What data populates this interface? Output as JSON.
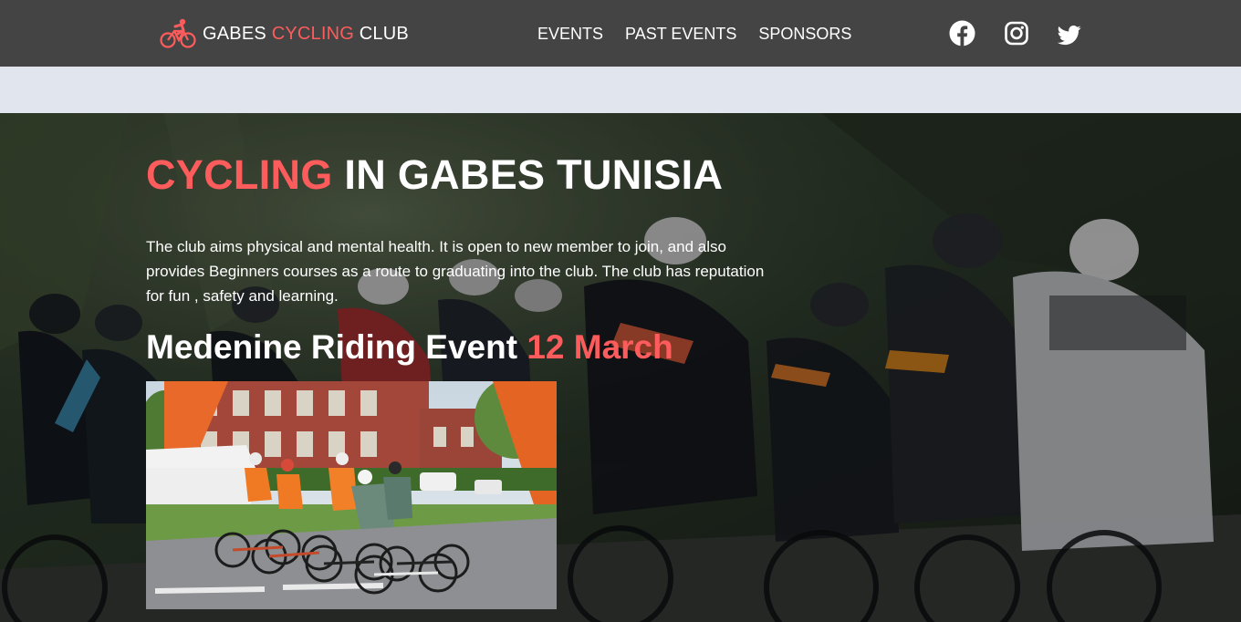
{
  "brand": {
    "name_part1": "GABES",
    "name_accent": "CYCLING",
    "name_part2": "CLUB",
    "logo_icon": "cyclist-icon",
    "accent_color": "#fc5c5c"
  },
  "nav": {
    "items": [
      {
        "label": "EVENTS"
      },
      {
        "label": "PAST EVENTS"
      },
      {
        "label": "SPONSORS"
      }
    ]
  },
  "social": {
    "icons": [
      "facebook-icon",
      "instagram-icon",
      "twitter-icon"
    ]
  },
  "hero": {
    "title_accent": "CYCLING",
    "title_rest": "IN GABES TUNISIA",
    "description": "The club aims physical and mental health. It is open to new member to join, and also provides Beginners courses as a route to graduating into the club. The club has reputation for fun , safety and learning.",
    "event_title": "Medenine Riding Event",
    "event_date": "12 March"
  },
  "colors": {
    "navbar": "#444444",
    "band": "#e1e5ee",
    "accent": "#fc5c5c"
  }
}
